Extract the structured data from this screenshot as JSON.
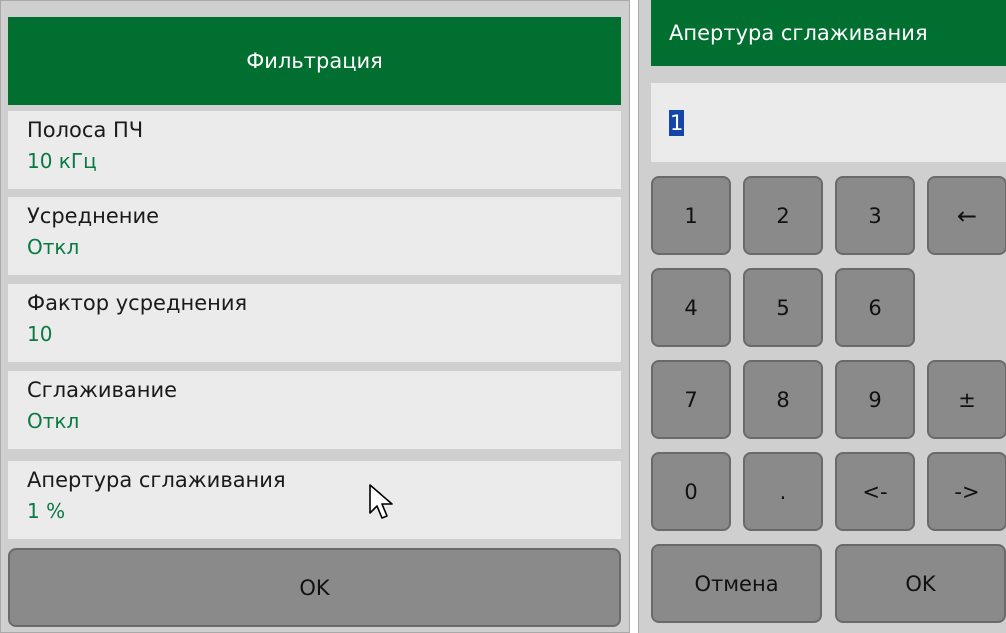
{
  "filter_panel": {
    "title": "Фильтрация",
    "items": [
      {
        "title": "Полоса ПЧ",
        "value": "10 кГц"
      },
      {
        "title": "Усреднение",
        "value": "Откл"
      },
      {
        "title": "Фактор усреднения",
        "value": "10"
      },
      {
        "title": "Сглаживание",
        "value": "Откл"
      },
      {
        "title": "Апертура сглаживания",
        "value": "1 %"
      }
    ],
    "ok_label": "OK"
  },
  "keypad": {
    "title": "Апертура сглаживания",
    "input_value": "1",
    "keys": {
      "k1": "1",
      "k2": "2",
      "k3": "3",
      "backspace": "←",
      "k4": "4",
      "k5": "5",
      "k6": "6",
      "k7": "7",
      "k8": "8",
      "k9": "9",
      "plusminus": "±",
      "k0": "0",
      "dot": ".",
      "left": "<-",
      "right": "->",
      "cancel": "Отмена",
      "ok": "OK"
    }
  },
  "colors": {
    "header_green": "#016f2f",
    "value_green": "#0a7a43",
    "selection_blue": "#1346a8",
    "key_gray": "#8a8a8a"
  }
}
